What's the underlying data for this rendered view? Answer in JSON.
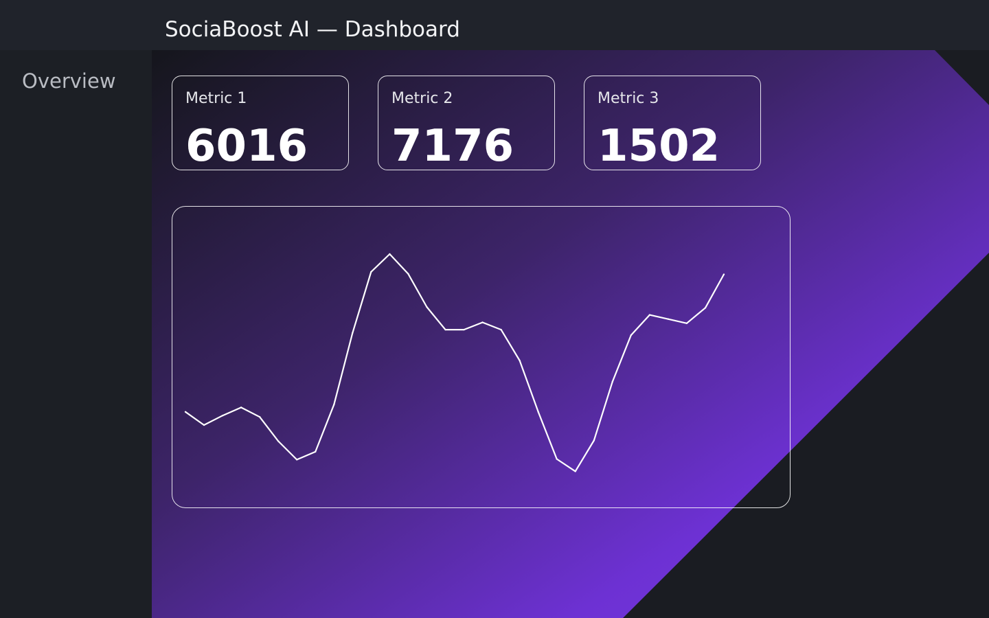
{
  "app": {
    "title": "SociaBoost AI — Dashboard"
  },
  "sidebar": {
    "items": [
      {
        "label": "Overview"
      }
    ]
  },
  "metrics": [
    {
      "label": "Metric 1",
      "value": "6016"
    },
    {
      "label": "Metric 2",
      "value": "7176"
    },
    {
      "label": "Metric 3",
      "value": "1502"
    }
  ],
  "colors": {
    "background": "#1a1c22",
    "topbar": "#20232b",
    "sidebar": "#1c1f25",
    "accent": "#7c3aed",
    "line": "#ffffff"
  },
  "chart_data": {
    "type": "line",
    "title": "",
    "xlabel": "",
    "ylabel": "",
    "grid": false,
    "x": [
      1,
      2,
      3,
      4,
      5,
      6,
      7,
      8,
      9,
      10,
      11,
      12,
      13,
      14,
      15,
      16,
      17,
      18,
      19,
      20,
      21,
      22,
      23,
      24,
      25,
      26,
      27,
      28,
      29,
      30
    ],
    "series": [
      {
        "values": [
          30.6,
          24.6,
          28.9,
          32.6,
          28.3,
          17.3,
          8.9,
          12.5,
          33.9,
          66.4,
          94.1,
          102.2,
          93.2,
          78.2,
          67.9,
          67.9,
          71.2,
          67.9,
          53.9,
          30.6,
          9.2,
          3.6,
          17.6,
          44.3,
          65.4,
          74.6,
          72.7,
          70.8,
          77.8,
          93.0
        ]
      }
    ]
  }
}
